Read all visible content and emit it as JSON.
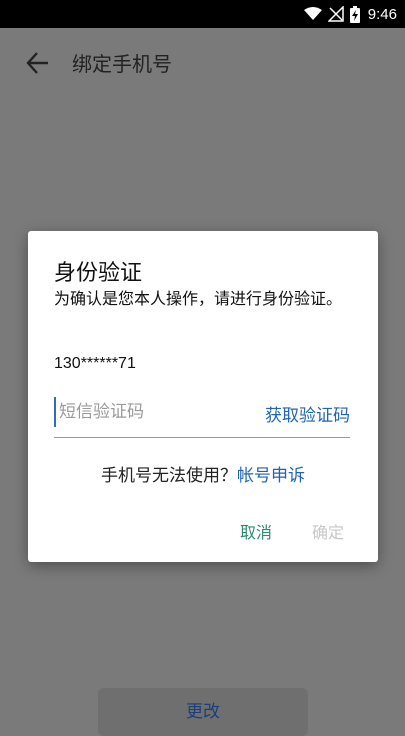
{
  "status_bar": {
    "time": "9:46",
    "icons": [
      "wifi-icon",
      "signal-off-icon",
      "battery-charging-icon"
    ]
  },
  "app_bar": {
    "back_icon": "arrow-left-icon",
    "title": "绑定手机号"
  },
  "background_button": {
    "label": "更改"
  },
  "dialog": {
    "title": "身份验证",
    "message": "为确认是您本人操作，请进行身份验证。",
    "phone": "130******71",
    "code_input": {
      "placeholder": "短信验证码",
      "value": ""
    },
    "get_code_label": "获取验证码",
    "appeal_prompt": "手机号无法使用？",
    "appeal_link": "帐号申诉",
    "cancel_label": "取消",
    "confirm_label": "确定"
  },
  "colors": {
    "link_blue": "#2163b4",
    "cancel_green": "#2f8a6d",
    "disabled_gray": "#c7c7c7",
    "background_dim": "#7a7a7a"
  }
}
